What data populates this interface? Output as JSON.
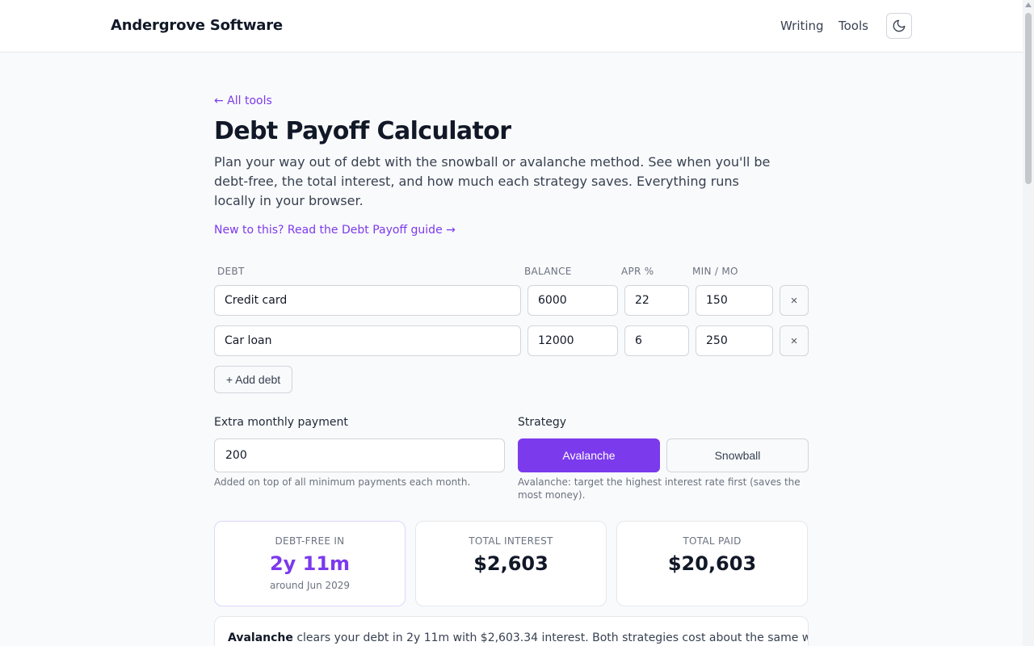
{
  "header": {
    "brand": "Andergrove Software",
    "nav": [
      {
        "label": "Writing"
      },
      {
        "label": "Tools"
      }
    ],
    "theme_toggle_icon": "moon-icon"
  },
  "page": {
    "back_link": "← All tools",
    "title": "Debt Payoff Calculator",
    "description": "Plan your way out of debt with the snowball or avalanche method. See when you'll be debt-free, the total interest, and how much each strategy saves. Everything runs locally in your browser.",
    "guide_link": "New to this? Read the Debt Payoff guide →"
  },
  "debts": {
    "columns": {
      "debt": "DEBT",
      "balance": "BALANCE",
      "apr": "APR %",
      "min": "MIN / MO"
    },
    "rows": [
      {
        "name": "Credit card",
        "balance": "6000",
        "apr": "22",
        "min": "150"
      },
      {
        "name": "Car loan",
        "balance": "12000",
        "apr": "6",
        "min": "250"
      }
    ],
    "remove_label": "×",
    "add_label": "+ Add debt"
  },
  "extra": {
    "label": "Extra monthly payment",
    "value": "200",
    "hint": "Added on top of all minimum payments each month."
  },
  "strategy": {
    "label": "Strategy",
    "options": [
      "Avalanche",
      "Snowball"
    ],
    "selected": "Avalanche",
    "hint": "Avalanche: target the highest interest rate first (saves the most money)."
  },
  "results": {
    "debt_free": {
      "label": "DEBT-FREE IN",
      "value": "2y 11m",
      "sub": "around Jun 2029"
    },
    "total_interest": {
      "label": "TOTAL INTEREST",
      "value": "$2,603"
    },
    "total_paid": {
      "label": "TOTAL PAID",
      "value": "$20,603"
    }
  },
  "summary": {
    "strategy": "Avalanche",
    "text": " clears your debt in 2y 11m with $2,603.34 interest. Both strategies cost about the same with"
  },
  "colors": {
    "accent": "#7c3aed"
  }
}
